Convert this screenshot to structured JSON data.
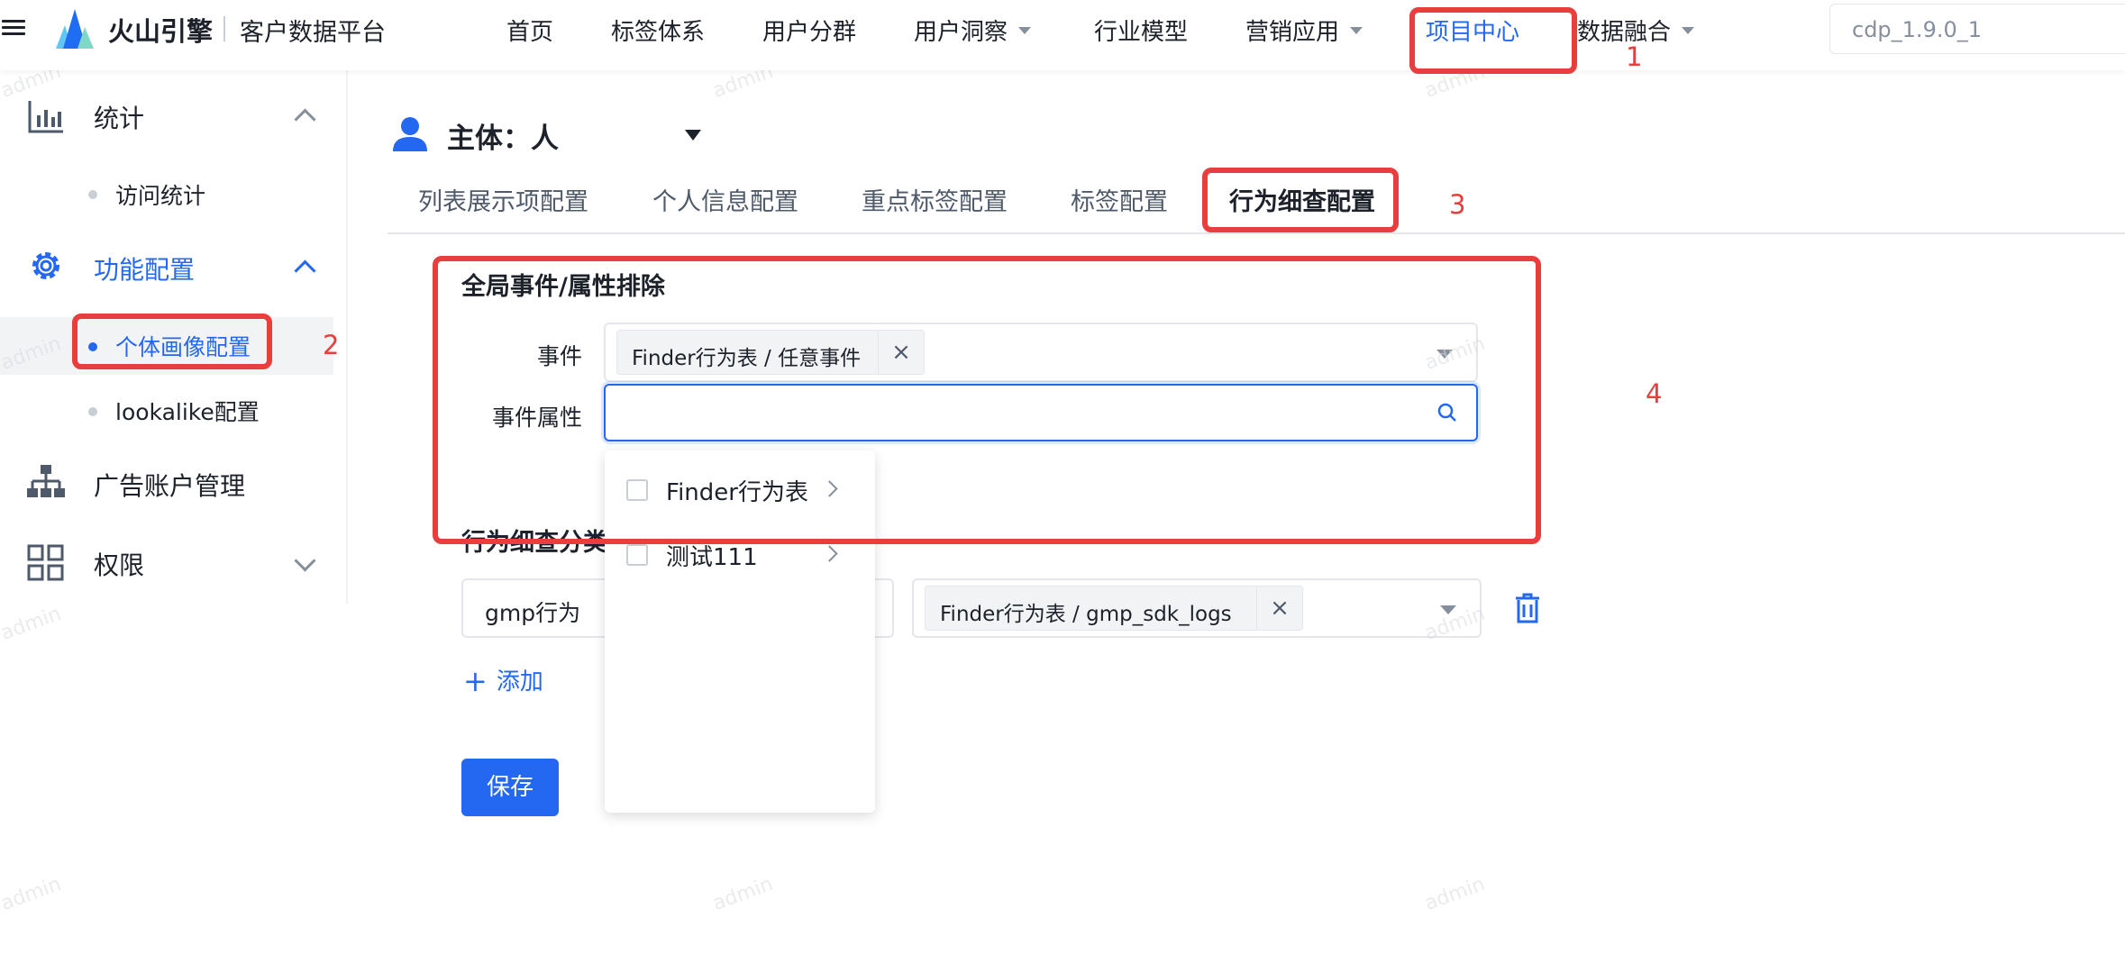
{
  "header": {
    "brand": "火山引擎",
    "product": "客户数据平台",
    "nav": [
      {
        "label": "首页"
      },
      {
        "label": "标签体系"
      },
      {
        "label": "用户分群"
      },
      {
        "label": "用户洞察"
      },
      {
        "label": "行业模型"
      },
      {
        "label": "营销应用"
      },
      {
        "label": "项目中心"
      },
      {
        "label": "数据融合"
      }
    ],
    "version": "cdp_1.9.0_1"
  },
  "sidebar": {
    "groups": [
      {
        "label": "统计"
      },
      {
        "label": "功能配置"
      },
      {
        "label": "广告账户管理"
      },
      {
        "label": "权限"
      }
    ],
    "subitems": [
      {
        "label": "访问统计"
      },
      {
        "label": "个体画像配置"
      },
      {
        "label": "lookalike配置"
      }
    ]
  },
  "main": {
    "subject": "主体：人",
    "tabs": [
      {
        "label": "列表展示项配置"
      },
      {
        "label": "个人信息配置"
      },
      {
        "label": "重点标签配置"
      },
      {
        "label": "标签配置"
      },
      {
        "label": "行为细查配置"
      }
    ],
    "global_section": {
      "title": "全局事件/属性排除",
      "event_label": "事件",
      "event_tag": "Finder行为表 / 任意事件",
      "attr_label": "事件属性",
      "attr_value": ""
    },
    "dropdown_items": [
      {
        "label": "Finder行为表"
      },
      {
        "label": "测试111"
      }
    ],
    "category_section": {
      "title": "行为细查分类",
      "row_name": "gmp行为",
      "row_tag": "Finder行为表 / gmp_sdk_logs"
    },
    "add_label": "添加",
    "save_label": "保存"
  },
  "annotations": [
    "1",
    "2",
    "3",
    "4"
  ],
  "watermark": "admin",
  "colors": {
    "accent": "#2468f2",
    "annotation": "#e83e3e"
  },
  "icons": [
    "menu-icon",
    "volcano-logo",
    "bar-chart-icon",
    "gear-icon",
    "org-chart-icon",
    "grid-icon",
    "user-icon",
    "search-icon",
    "trash-icon",
    "plus-icon"
  ]
}
